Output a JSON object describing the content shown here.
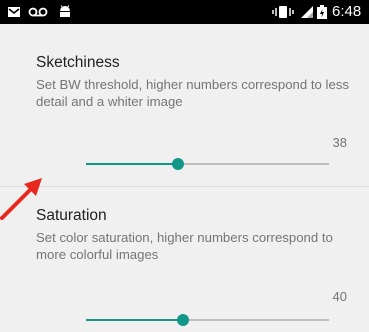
{
  "status_bar": {
    "time": "6:48",
    "icons": [
      "mail-icon",
      "voicemail-icon",
      "android-icon",
      "vibrate-icon",
      "signal-icon",
      "battery-icon"
    ]
  },
  "settings": [
    {
      "title": "Sketchiness",
      "summary": "Set BW threshold, higher numbers correspond to less detail and a whiter image",
      "value": "38",
      "fill_fraction": 0.38
    },
    {
      "title": "Saturation",
      "summary": "Set color saturation, higher numbers correspond to more colorful images",
      "value": "40",
      "fill_fraction": 0.4
    }
  ],
  "colors": {
    "accent": "#129688",
    "arrow": "#e8281e"
  }
}
